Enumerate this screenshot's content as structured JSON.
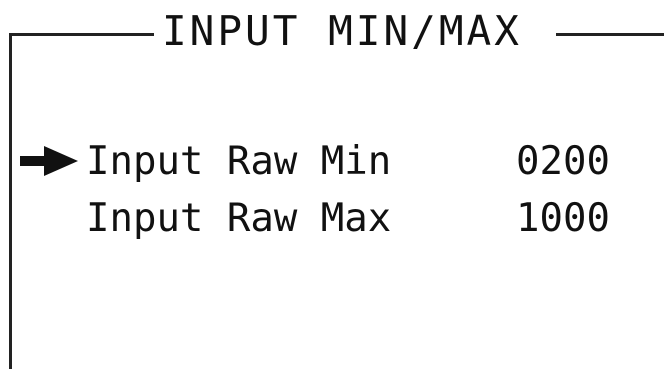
{
  "screen": {
    "title": "INPUT MIN/MAX"
  },
  "menu": {
    "items": [
      {
        "label": "Input Raw Min",
        "value": "0200",
        "selected": true
      },
      {
        "label": "Input Raw Max",
        "value": "1000",
        "selected": false
      }
    ]
  },
  "icons": {
    "cursor": "selection-arrow-icon"
  },
  "colors": {
    "background": "#ffffff",
    "foreground": "#111111"
  }
}
